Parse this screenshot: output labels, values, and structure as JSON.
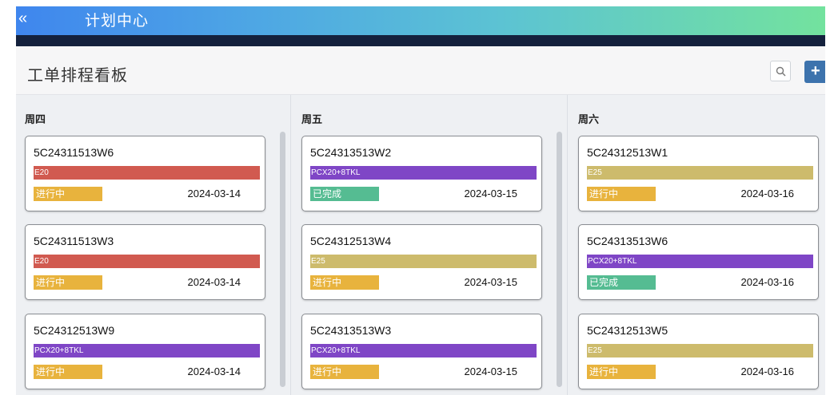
{
  "app": {
    "title": "计划中心",
    "back_icon": "chevron-left-icon"
  },
  "header": {
    "title": "工单排程看板",
    "search_icon": "search-icon",
    "add_label": "+"
  },
  "colors": {
    "E20": "#d15a50",
    "PCX20+8TKL": "#7f46c6",
    "E25": "#cdbb6c",
    "进行中": "#e8b33d",
    "已完成": "#55bc92"
  },
  "columns": [
    {
      "title": "周四",
      "cards": [
        {
          "id": "5C24311513W6",
          "type": "E20",
          "status": "进行中",
          "date": "2024-03-14"
        },
        {
          "id": "5C24311513W3",
          "type": "E20",
          "status": "进行中",
          "date": "2024-03-14"
        },
        {
          "id": "5C24312513W9",
          "type": "PCX20+8TKL",
          "status": "进行中",
          "date": "2024-03-14"
        }
      ]
    },
    {
      "title": "周五",
      "cards": [
        {
          "id": "5C24313513W2",
          "type": "PCX20+8TKL",
          "status": "已完成",
          "date": "2024-03-15"
        },
        {
          "id": "5C24312513W4",
          "type": "E25",
          "status": "进行中",
          "date": "2024-03-15"
        },
        {
          "id": "5C24313513W3",
          "type": "PCX20+8TKL",
          "status": "进行中",
          "date": "2024-03-15"
        }
      ]
    },
    {
      "title": "周六",
      "cards": [
        {
          "id": "5C24312513W1",
          "type": "E25",
          "status": "进行中",
          "date": "2024-03-16"
        },
        {
          "id": "5C24313513W6",
          "type": "PCX20+8TKL",
          "status": "已完成",
          "date": "2024-03-16"
        },
        {
          "id": "5C24312513W5",
          "type": "E25",
          "status": "进行中",
          "date": "2024-03-16"
        }
      ]
    }
  ]
}
